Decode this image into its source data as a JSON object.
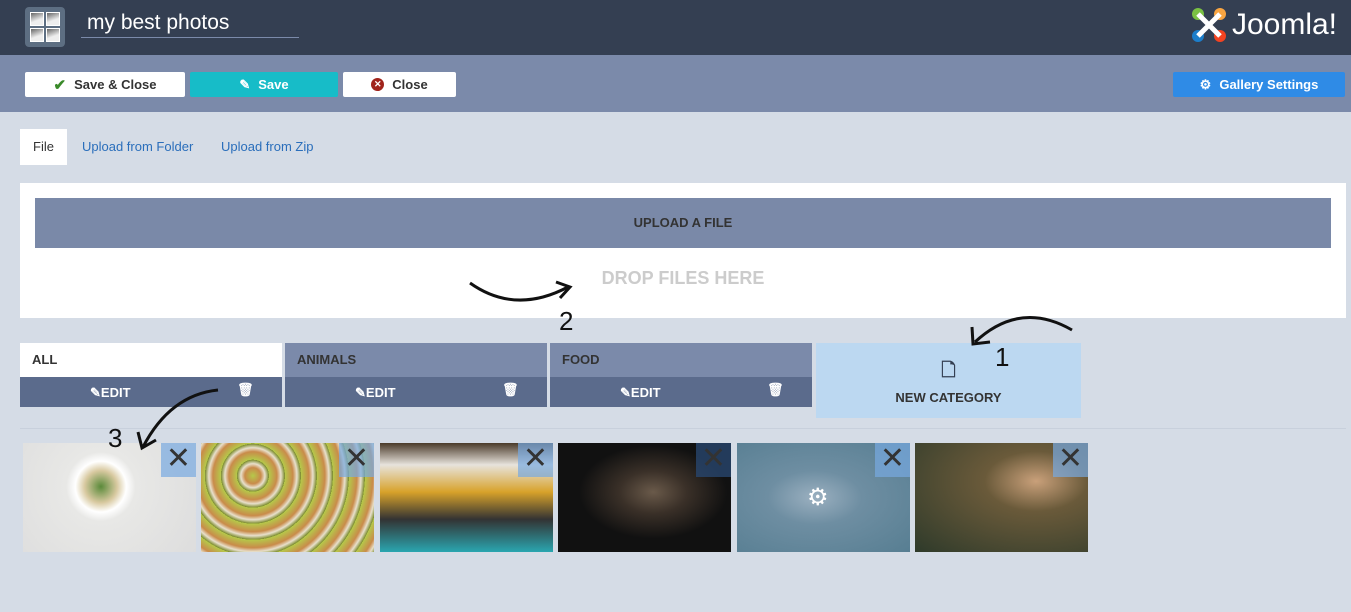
{
  "header": {
    "title": "my best photos",
    "brand": "Joomla!",
    "app_icon": "gallery-icon"
  },
  "toolbar": {
    "save_close": "Save & Close",
    "save": "Save",
    "close": "Close",
    "gallery_settings": "Gallery Settings"
  },
  "tabs": [
    {
      "label": "File",
      "active": true
    },
    {
      "label": "Upload from Folder"
    },
    {
      "label": "Upload from Zip"
    }
  ],
  "upload": {
    "button": "UPLOAD A FILE",
    "drop": "DROP FILES HERE"
  },
  "categories": [
    {
      "name": "ALL",
      "active": true,
      "edit": "EDIT"
    },
    {
      "name": "ANIMALS",
      "edit": "EDIT"
    },
    {
      "name": "FOOD",
      "edit": "EDIT"
    }
  ],
  "new_category": "NEW CATEGORY",
  "thumbnails": [
    {
      "subject": "salad plate"
    },
    {
      "subject": "sushi rolls"
    },
    {
      "subject": "cake and mug"
    },
    {
      "subject": "cat"
    },
    {
      "subject": "puppies",
      "hover": true
    },
    {
      "subject": "monkey"
    }
  ],
  "annotations": [
    "1",
    "2",
    "3"
  ],
  "colors": {
    "header": "#343f52",
    "toolbar": "#7b8aaa",
    "save": "#17bcc8",
    "settings": "#2f8be6",
    "new_category": "#bcd8f1"
  }
}
